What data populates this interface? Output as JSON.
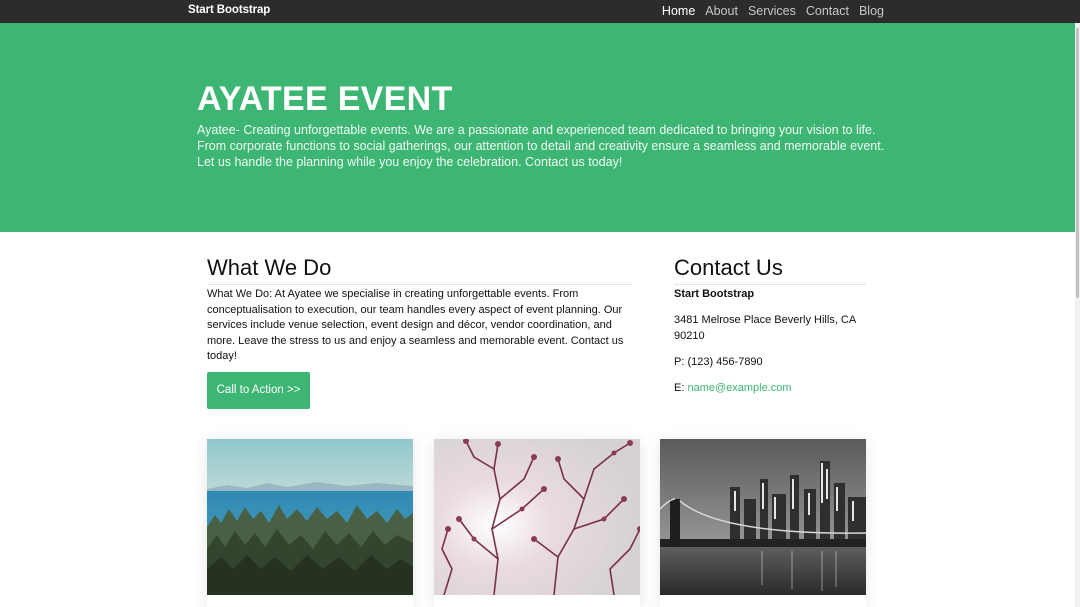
{
  "navbar": {
    "brand": "Start Bootstrap",
    "links": [
      "Home",
      "About",
      "Services",
      "Contact",
      "Blog"
    ]
  },
  "hero": {
    "title": "AYATEE EVENT",
    "description": "Ayatee- Creating unforgettable events. We are a passionate and experienced team dedicated to bringing your vision to life. From corporate functions to social gatherings, our attention to detail and creativity ensure a seamless and memorable event. Let us handle the planning while you enjoy the celebration. Contact us today!"
  },
  "what_we_do": {
    "heading": "What We Do",
    "body": "What We Do: At Ayatee we specialise in creating unforgettable events. From conceptualisation to execution, our team handles every aspect of event planning. Our services include venue selection, event design and décor, vendor coordination, and more. Leave the stress to us and enjoy a seamless and memorable event. Contact us today!",
    "button": "Call to Action >>"
  },
  "contact": {
    "heading": "Contact Us",
    "name": "Start Bootstrap",
    "address": "3481 Melrose Place Beverly Hills, CA 90210",
    "phone": "P: (123) 456-7890",
    "email_prefix": "E:",
    "email": "name@example.com"
  },
  "colors": {
    "accent": "#3cb672",
    "navbar": "#2c2c2c"
  },
  "cards": [
    {
      "image": "forest-lake-photo"
    },
    {
      "image": "pink-branches-photo"
    },
    {
      "image": "city-bridge-night-photo"
    }
  ]
}
